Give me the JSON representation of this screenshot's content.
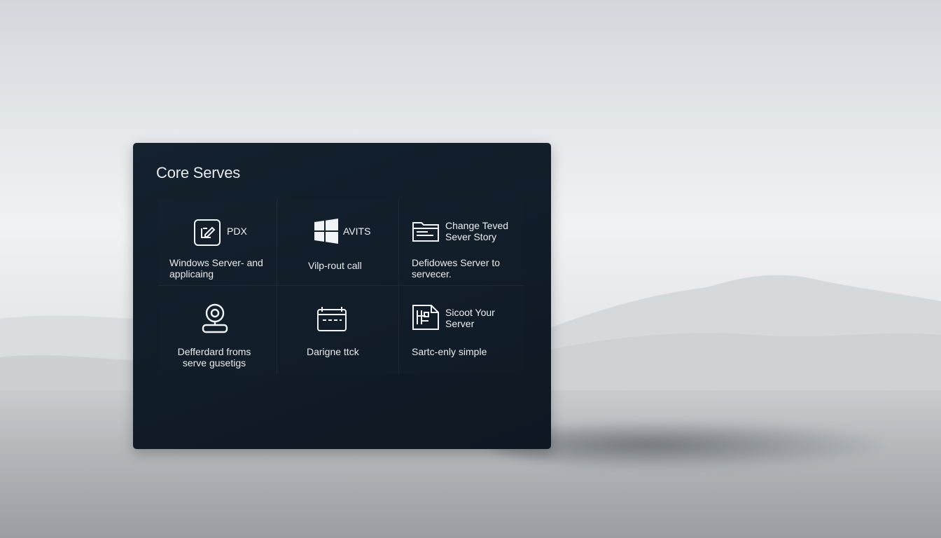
{
  "panel": {
    "title": "Core Serves",
    "tiles": [
      {
        "icon": "document-pen-icon",
        "label": "PDX",
        "description": "Windows Server- and\napplicaing"
      },
      {
        "icon": "windows-logo-icon",
        "label": "AVITS",
        "description": "Vilp-rout call"
      },
      {
        "icon": "folder-icon",
        "label": "Change Teved\nSever Story",
        "description": "Defidowes Server to\nservecer."
      },
      {
        "icon": "webcam-icon",
        "label": "",
        "description": "Defferdard froms\nserve gusetigs"
      },
      {
        "icon": "calendar-icon",
        "label": "",
        "description": "Darigne ttck"
      },
      {
        "icon": "document-stack-icon",
        "label": "Sicoot Your\nServer",
        "description": "Sartc-enly simple"
      }
    ]
  }
}
